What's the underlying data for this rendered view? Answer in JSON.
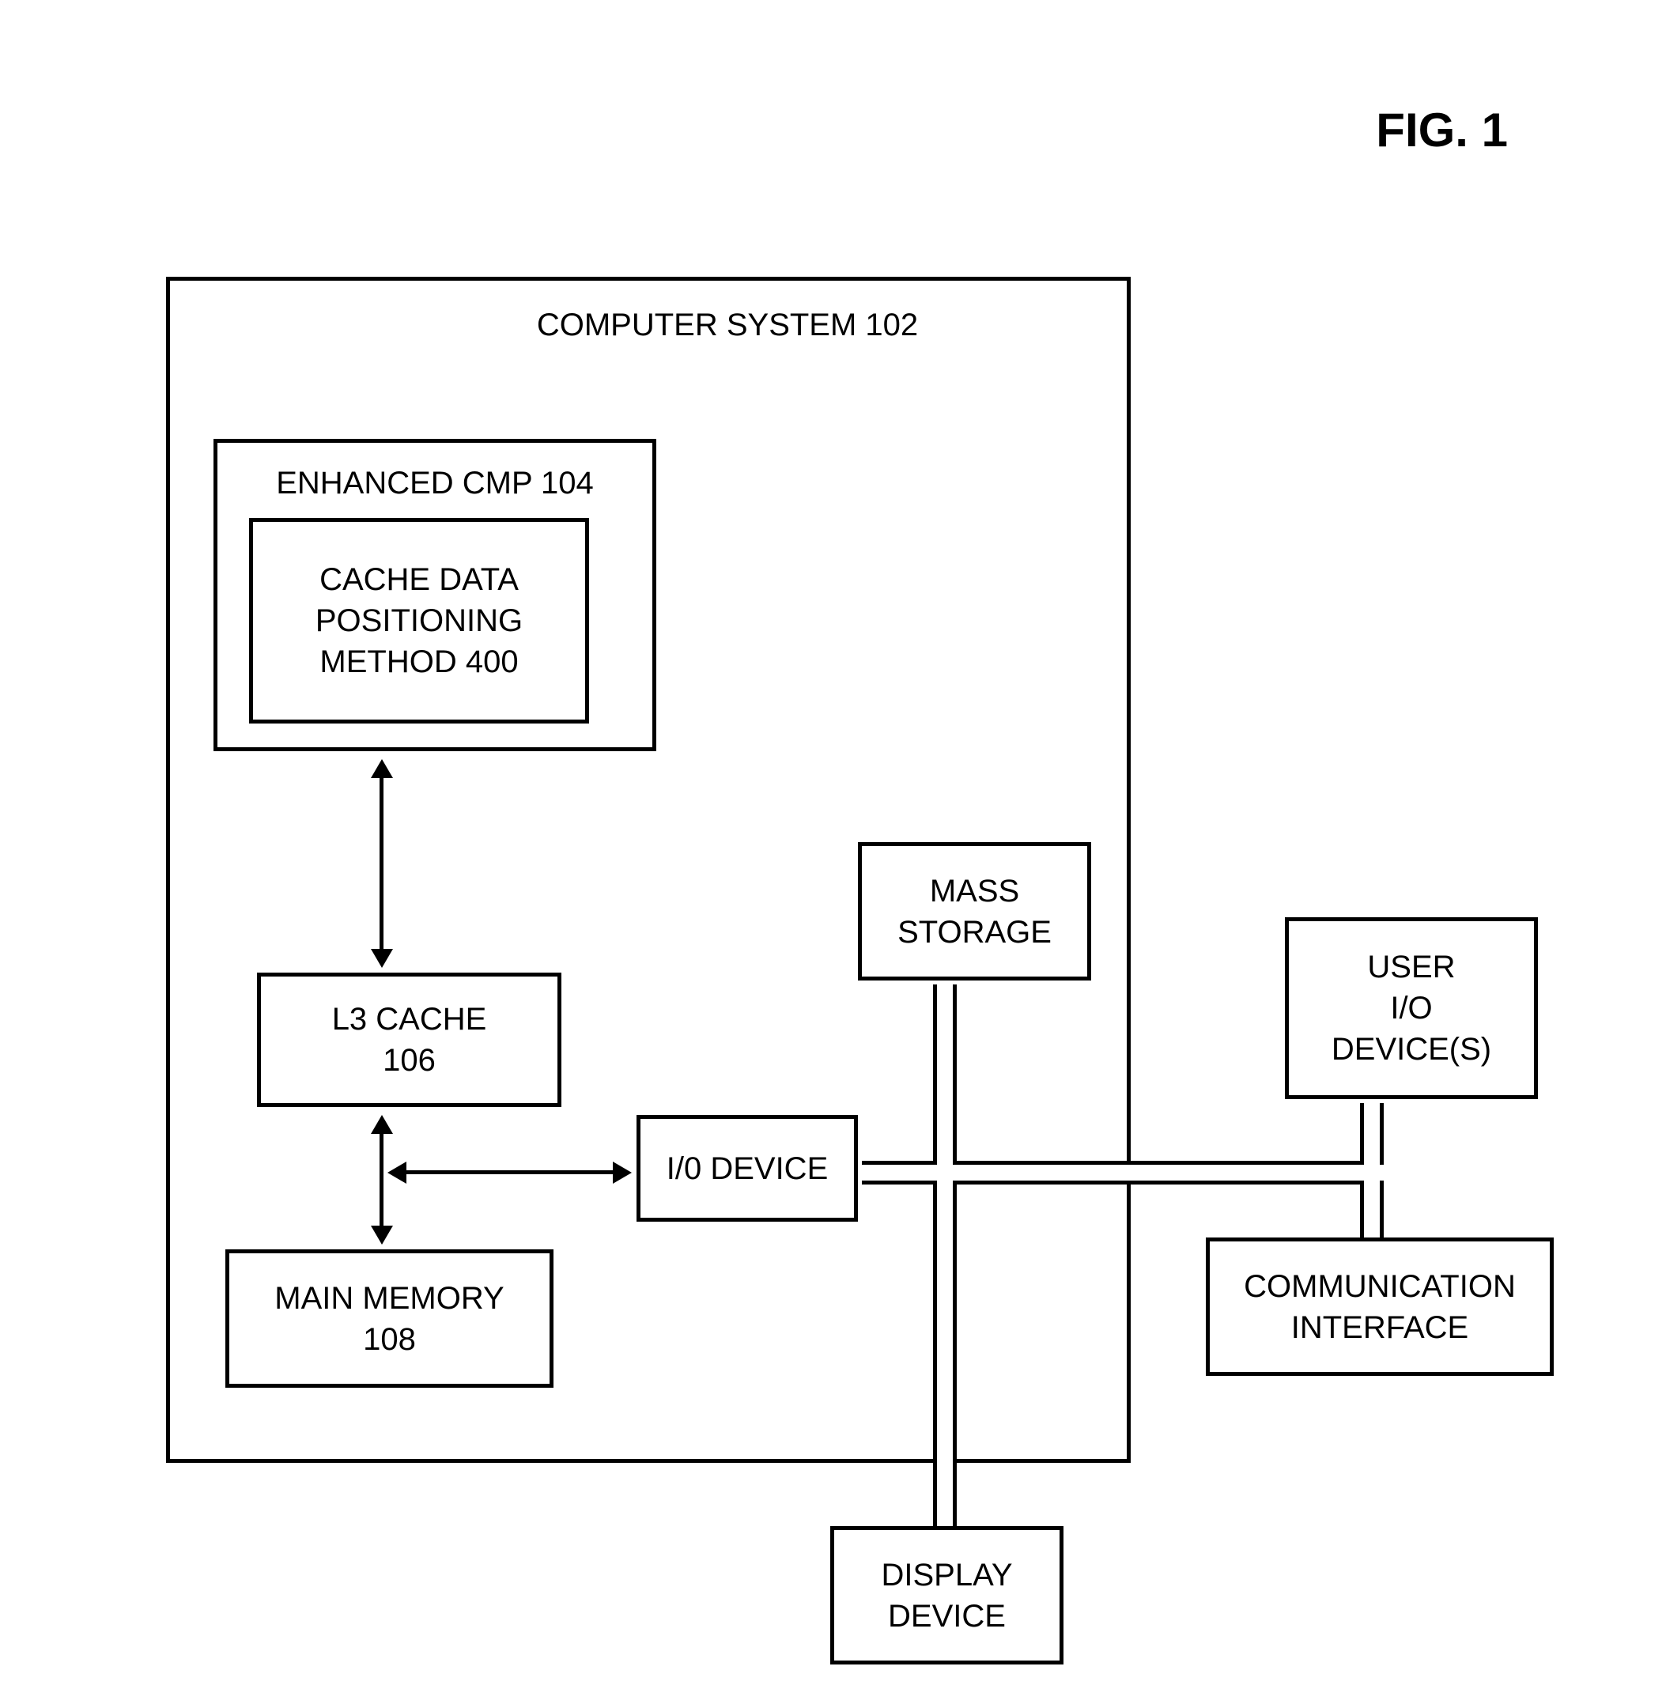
{
  "figure_title": "FIG. 1",
  "computer_system": {
    "label": "COMPUTER SYSTEM 102"
  },
  "enhanced_cmp": {
    "label": "ENHANCED  CMP 104"
  },
  "cache_data_method": {
    "line1": "CACHE DATA",
    "line2": "POSITIONING",
    "line3": "METHOD  400"
  },
  "l3_cache": {
    "line1": "L3 CACHE",
    "line2": "106"
  },
  "main_memory": {
    "line1": "MAIN MEMORY",
    "line2": "108"
  },
  "io_device": {
    "label": "I/0 DEVICE"
  },
  "mass_storage": {
    "line1": "MASS",
    "line2": "STORAGE"
  },
  "user_io": {
    "line1": "USER",
    "line2": "I/O",
    "line3": "DEVICE(S)"
  },
  "comm_interface": {
    "line1": "COMMUNICATION",
    "line2": "INTERFACE"
  },
  "display_device": {
    "line1": "DISPLAY",
    "line2": "DEVICE"
  }
}
